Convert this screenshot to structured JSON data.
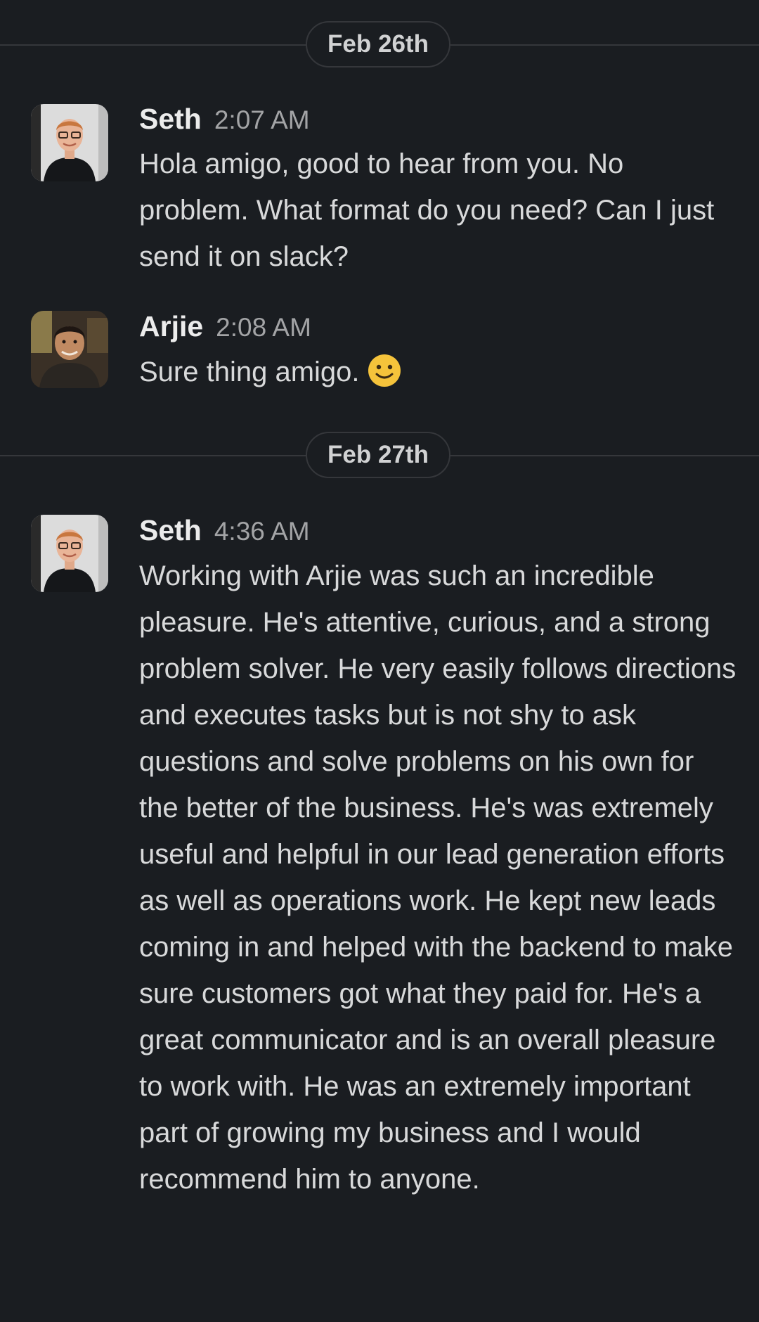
{
  "dates": {
    "first": "Feb 26th",
    "second": "Feb 27th"
  },
  "messages": [
    {
      "author": "Seth",
      "time": "2:07 AM",
      "text": "Hola amigo, good to hear from you. No problem. What format do you need? Can I just send it on slack?"
    },
    {
      "author": "Arjie",
      "time": "2:08 AM",
      "text": "Sure thing amigo.",
      "emoji": "slightly-smiling-face-icon"
    },
    {
      "author": "Seth",
      "time": "4:36 AM",
      "text": "Working with Arjie was such an incredible pleasure. He's attentive, curious, and a strong problem solver. He very easily follows directions and executes tasks but is not shy to ask questions and solve problems on his own for the better of the business. He's was extremely useful and helpful in our lead generation efforts as well as operations work. He kept new leads coming in and helped with the backend to make sure customers got what they paid for. He's a great communicator and is an overall pleasure to work with. He was an extremely important part of growing my business and I would recommend him to anyone."
    }
  ],
  "colors": {
    "background": "#1a1d21",
    "divider": "#35373b",
    "text": "#d1d2d3",
    "emoji": "#f5c33b"
  }
}
